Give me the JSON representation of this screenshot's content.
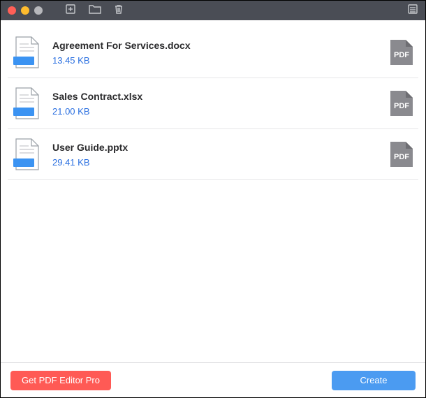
{
  "toolbar": {
    "add_icon": "add-file-icon",
    "folder_icon": "folder-icon",
    "trash_icon": "trash-icon",
    "list_icon": "list-icon"
  },
  "files": [
    {
      "name": "Agreement For Services.docx",
      "size": "13.45 KB",
      "output": "PDF"
    },
    {
      "name": "Sales Contract.xlsx",
      "size": "21.00 KB",
      "output": "PDF"
    },
    {
      "name": "User Guide.pptx",
      "size": "29.41 KB",
      "output": "PDF"
    }
  ],
  "footer": {
    "pro_label": "Get PDF Editor Pro",
    "create_label": "Create"
  }
}
